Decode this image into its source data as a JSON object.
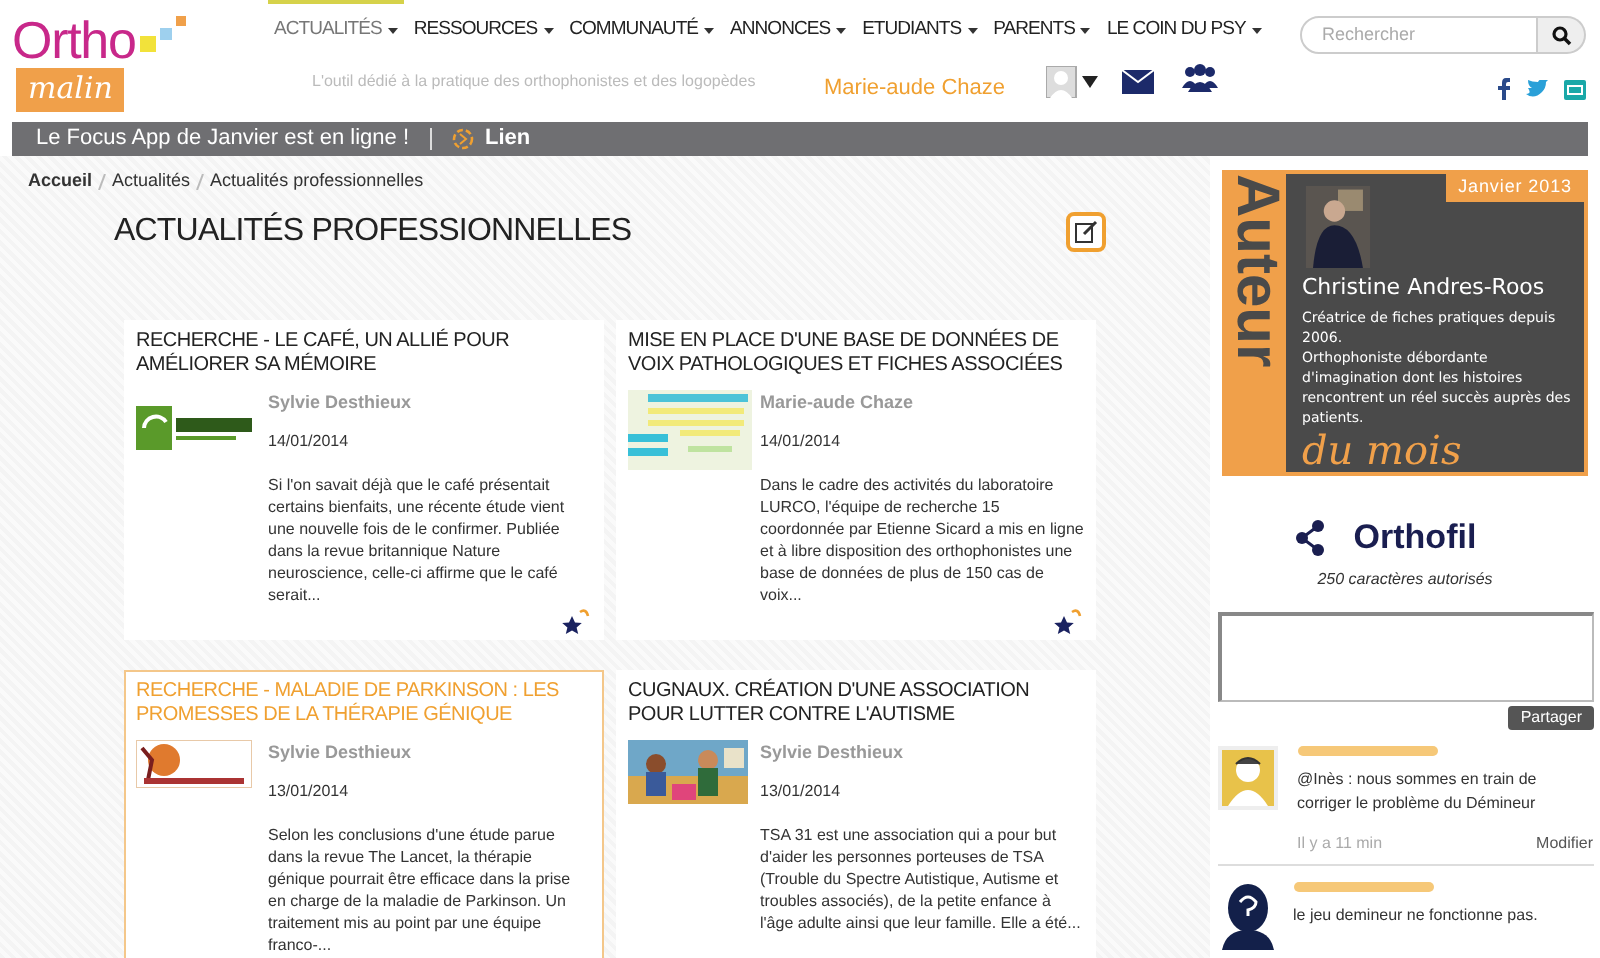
{
  "logo": {
    "word_top": "Ortho",
    "word_bottom": "malin"
  },
  "nav": [
    {
      "label": "ACTUALITÉS",
      "selected": true
    },
    {
      "label": "RESSOURCES",
      "selected": false
    },
    {
      "label": "COMMUNAUTÉ",
      "selected": false
    },
    {
      "label": "ANNONCES",
      "selected": false
    },
    {
      "label": "ETUDIANTS",
      "selected": false
    },
    {
      "label": "PARENTS",
      "selected": false
    },
    {
      "label": "LE COIN DU PSY",
      "selected": false
    }
  ],
  "tagline": "L'outil dédié à la pratique des orthophonistes et des logopèdes",
  "user": "Marie-aude Chaze",
  "search": {
    "placeholder": "Rechercher"
  },
  "announcement": {
    "text": "Le Focus App de Janvier est en ligne !",
    "link": "Lien"
  },
  "breadcrumb": [
    "Accueil",
    "Actualités",
    "Actualités professionnelles"
  ],
  "page_title": "ACTUALITÉS PROFESSIONNELLES",
  "articles": [
    {
      "title": "RECHERCHE - LE CAFÉ, UN ALLIÉ POUR AMÉLIORER SA MÉMOIRE",
      "author": "Sylvie Desthieux",
      "date": "14/01/2014",
      "excerpt": "Si l'on savait déjà que le café présentait certains bienfaits, une récente étude vient une nouvelle fois de le confirmer. Publiée dans la revue britannique Nature neuroscience, celle-ci affirme que le café serait...",
      "highlighted": false,
      "kind": "logo-green"
    },
    {
      "title": "MISE EN PLACE D'UNE BASE DE DONNÉES DE VOIX PATHOLOGIQUES ET FICHES ASSOCIÉES",
      "author": "Marie-aude Chaze",
      "date": "14/01/2014",
      "excerpt": "Dans le cadre des activités du laboratoire LURCO, l'équipe de recherche 15 coordonnée par Etienne Sicard a mis en ligne et à libre disposition des orthophonistes une base de données de plus de 150 cas de voix...",
      "highlighted": false,
      "kind": "table"
    },
    {
      "title": "RECHERCHE - MALADIE DE PARKINSON : LES PROMESSES DE LA THÉRAPIE GÉNIQUE",
      "author": "Sylvie Desthieux",
      "date": "13/01/2014",
      "excerpt": "Selon les conclusions d'une étude parue dans la revue The Lancet, la thérapie génique pourrait être efficace dans la prise en charge de la maladie de Parkinson. Un traitement mis au point par une équipe franco-...",
      "highlighted": true,
      "kind": "logo-orange"
    },
    {
      "title": "CUGNAUX. CRÉATION D'UNE ASSOCIATION POUR LUTTER CONTRE L'AUTISME",
      "author": "Sylvie Desthieux",
      "date": "13/01/2014",
      "excerpt": "TSA 31 est une association qui a pour but d'aider les personnes porteuses de TSA (Trouble du Spectre Autistique, Autisme et troubles associés), de la petite enfance à l'âge adulte ainsi que leur famille. Elle a été...",
      "highlighted": false
    }
  ],
  "author_of_month": {
    "side": "Auteur",
    "month": "Janvier 2013",
    "name": "Christine Andres-Roos",
    "bio": "Créatrice de fiches pratiques depuis 2006.\nOrthophoniste débordante d'imagination dont les histoires rencontrent un réel succès auprès des patients.",
    "footer": "du mois"
  },
  "orthofil": {
    "title": "Orthofil",
    "hint": "250 caractères autorisés",
    "button": "Partager"
  },
  "comments": [
    {
      "text": "@Inès : nous sommes en train de corriger le problème du Démineur",
      "time": "Il y a 11 min",
      "action": "Modifier",
      "kind": "picture"
    },
    {
      "text": "le jeu demineur ne fonctionne pas.",
      "kind": "silhouette"
    }
  ]
}
